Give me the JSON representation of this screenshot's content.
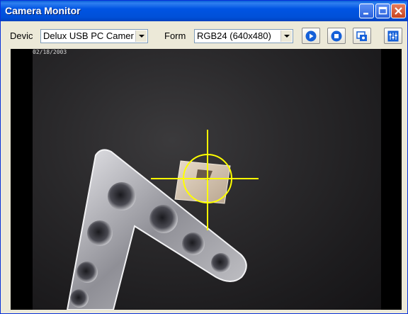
{
  "window": {
    "title": "Camera Monitor"
  },
  "toolbar": {
    "device_label": "Devic",
    "device_value": "Delux USB PC Camer",
    "format_label": "Form",
    "format_value": "RGB24 (640x480)"
  },
  "video": {
    "timestamp": "02/18/2003"
  },
  "colors": {
    "titlebar": "#0054e3",
    "crosshair": "#ffff00",
    "accent_button": "#1560d8"
  },
  "icons": [
    "minimize-icon",
    "maximize-icon",
    "close-icon",
    "play-icon",
    "stop-icon",
    "snapshot-icon",
    "settings-icon"
  ]
}
